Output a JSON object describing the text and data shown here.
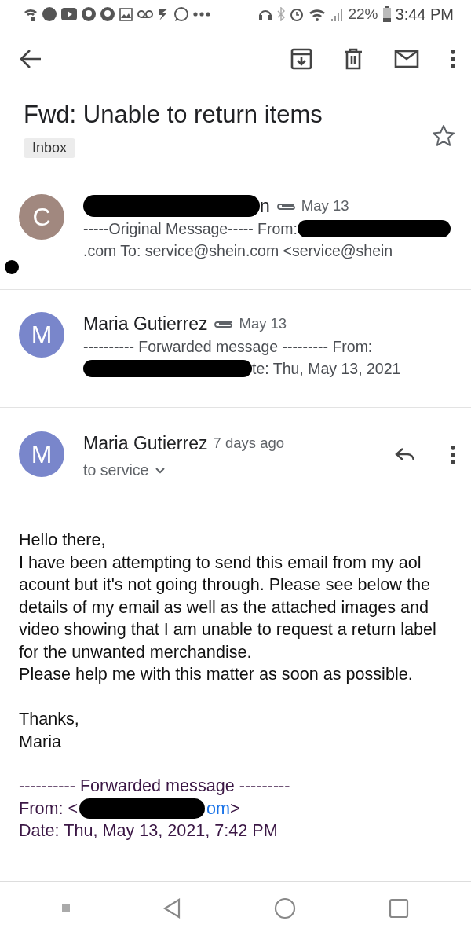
{
  "status_bar": {
    "battery": "22%",
    "time": "3:44 PM"
  },
  "subject": "Fwd: Unable to return items",
  "label": "Inbox",
  "starred": false,
  "messages": [
    {
      "avatar_letter": "C",
      "color": "#a1887f",
      "expanded": false,
      "attachment": true,
      "date": "May 13",
      "sender": [
        {
          "kind": "redaction"
        },
        {
          "kind": "text",
          "text": "n"
        }
      ],
      "snippet": [
        [
          {
            "kind": "text",
            "text": "-----Original Message----- From: "
          },
          {
            "kind": "redaction"
          }
        ],
        [
          {
            "kind": "text",
            "text": ".com To: service@shein.com <service@shein"
          }
        ]
      ]
    },
    {
      "avatar_letter": "M",
      "color": "#7986cb",
      "expanded": false,
      "attachment": true,
      "date": "May 13",
      "sender": [
        {
          "kind": "text",
          "text": "Maria Gutierrez"
        }
      ],
      "snippet": [
        [
          {
            "kind": "text",
            "text": "---------- Forwarded message --------- From:"
          }
        ],
        [
          {
            "kind": "redaction"
          },
          {
            "kind": "text",
            "text": "te: Thu, May 13, 2021"
          }
        ]
      ]
    },
    {
      "avatar_letter": "M",
      "color": "#7986cb",
      "expanded": true,
      "attachment": false,
      "date": "7 days ago",
      "sender": [
        {
          "kind": "text",
          "text": "Maria Gutierrez"
        }
      ],
      "recipients": "to service"
    }
  ],
  "body": [
    "Hello there,",
    "I have been attempting to send this email from my aol acount but it's not going through. Please see below the details of my email as well as the attached images and video showing that I am unable to request a return label for the unwanted merchandise.",
    "Please help me with this matter as soon as possible."
  ],
  "signature": [
    "Thanks,",
    "Maria"
  ],
  "forwarded": [
    [
      {
        "kind": "text",
        "text": "---------- Forwarded message ---------"
      }
    ],
    [
      {
        "kind": "text",
        "text": "From: <"
      },
      {
        "kind": "redaction"
      },
      {
        "kind": "link",
        "text": "om"
      },
      {
        "kind": "text",
        "text": ">"
      }
    ],
    [
      {
        "kind": "text",
        "text": "Date: Thu, May 13, 2021, 7:42 PM"
      }
    ]
  ]
}
